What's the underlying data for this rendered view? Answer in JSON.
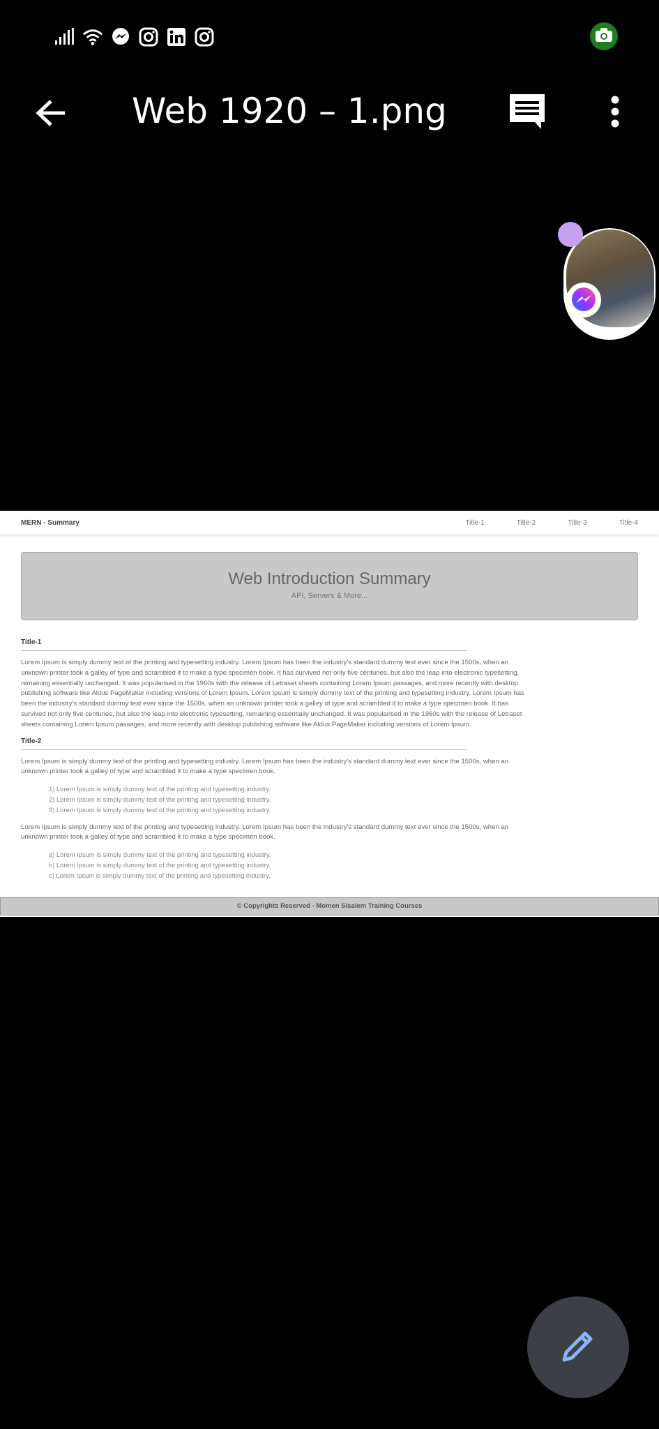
{
  "status_bar": {
    "icons": [
      "signal-icon",
      "wifi-icon",
      "messenger-icon",
      "instagram-icon",
      "linkedin-icon",
      "instagram-icon"
    ],
    "screenshot_badge": "camera-icon"
  },
  "app_bar": {
    "title": "Web 1920 – 1.png",
    "back_icon": "arrow-back-icon",
    "comment_icon": "comment-icon",
    "more_icon": "more-vert-icon"
  },
  "chat_head": {
    "badge": "messenger-icon"
  },
  "document": {
    "nav": {
      "brand": "MERN - Summary",
      "links": [
        "Title-1",
        "Title-2",
        "Title-3",
        "Title-4"
      ]
    },
    "hero": {
      "title": "Web Introduction Summary",
      "subtitle": "API, Servers & More..."
    },
    "sections": [
      {
        "title": "Title-1",
        "paragraph": "Lorem Ipsum is simply dummy text of the printing and typesetting industry. Lorem Ipsum has been the industry's standard dummy text ever since the 1500s, when an unknown printer took a galley of type and scrambled it to make a type specimen book. It has survived not only five centuries, but also the leap into electronic typesetting, remaining essentially unchanged. It was popularised in the 1960s with the release of Letraset sheets containing Lorem Ipsum passages, and more recently with desktop publishing software like Aldus PageMaker including versions of Lorem Ipsum. Lorem Ipsum is simply dummy text of the printing and typesetting industry. Lorem Ipsum has been the industry's standard dummy text ever since the 1500s, when an unknown printer took a galley of type and scrambled it to make a type specimen book. It has survived not only five centuries, but also the leap into electronic typesetting, remaining essentially unchanged. It was popularised in the 1960s with the release of Letraset sheets containing Lorem Ipsum passages, and more recently with desktop publishing software like Aldus PageMaker including versions of Lorem Ipsum."
      },
      {
        "title": "Title-2",
        "paragraph": "Lorem Ipsum is simply dummy text of the printing and typesetting industry. Lorem Ipsum has been the industry's standard dummy text ever since the 1500s, when an unknown printer took a galley of type and scrambled it to make a type specimen book.",
        "numbered_list": [
          "1) Lorem Ipsum is simply dummy text of the printing and typesetting industry.",
          "2) Lorem Ipsum is simply dummy text of the printing and typesetting industry.",
          "3) Lorem Ipsum is simply dummy text of the printing and typesetting industry."
        ],
        "paragraph2": "Lorem Ipsum is simply dummy text of the printing and typesetting industry. Lorem Ipsum has been the industry's standard dummy text ever since the 1500s, when an unknown printer took a galley of type and scrambled it to make a type specimen book.",
        "lettered_list": [
          "a) Lorem Ipsum is simply dummy text of the printing and typesetting industry.",
          "b) Lorem Ipsum is simply dummy text of the printing and typesetting industry.",
          "c) Lorem Ipsum is simply dummy text of the printing and typesetting industry."
        ]
      }
    ],
    "footer": "© Copyrights Reserved - Momen Sisalem Training Courses"
  },
  "fab": {
    "icon": "edit-pencil-icon",
    "color": "#8ab4f8"
  },
  "colors": {
    "background": "#000000",
    "fab_bg": "#3c3f45",
    "camera_badge": "#1e7d1e",
    "chat_dot": "#c8a0f0"
  }
}
